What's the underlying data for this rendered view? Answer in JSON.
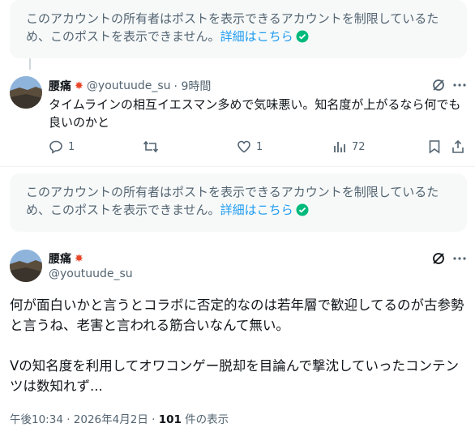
{
  "notice": {
    "text": "このアカウントの所有者はポストを表示できるアカウントを制限しているため、このポストを表示できません。",
    "link": "詳細はこちら"
  },
  "reply": {
    "name": "腰痛",
    "handle": "@youtuude_su",
    "time": "· 9時間",
    "text": "タイムラインの相互イエスマン多めで気味悪い。知名度が上がるなら何でも良いのかと",
    "replies": "1",
    "likes": "1",
    "views": "72"
  },
  "main": {
    "name": "腰痛",
    "handle": "@youtuude_su",
    "para1": "何が面白いかと言うとコラボに否定的なのは若年層で歓迎してるのが古参勢と言うね、老害と言われる筋合いなんて無い。",
    "para2": "Vの知名度を利用してオワコンゲー脱却を目論んで撃沈していったコンテンツは数知れず...",
    "timestamp": "午後10:34 · 2026年4月2日 · ",
    "views_count": "101",
    "views_label": " 件の表示"
  }
}
